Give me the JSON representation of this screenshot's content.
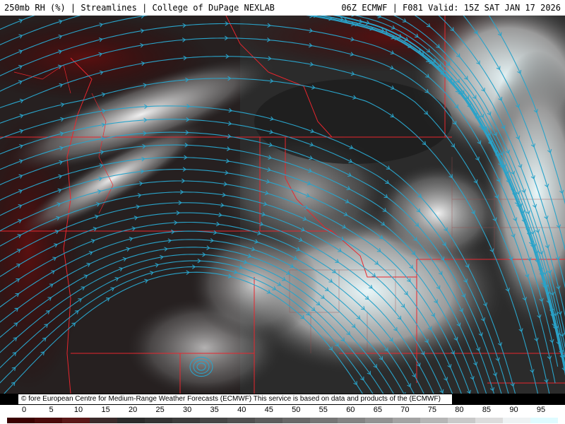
{
  "header": {
    "left_text": "250mb RH (%) | Streamlines | College of DuPage NEXLAB",
    "right_text": "06Z ECMWF | F081 Valid: 15Z SAT JAN 17 2026"
  },
  "map": {
    "field": "250mb RH (%)",
    "overlay": "Streamlines",
    "streamline_color": "#2aa3c9",
    "border_color": "#e8262e",
    "bg_dry": "#3a0000",
    "bg_moist": "#e8fbff"
  },
  "credit_text": "© fore European Centre for Medium-Range Weather Forecasts (ECMWF)  This service is based on data and products of the (ECMWF)",
  "scale": {
    "ticks": [
      "0",
      "5",
      "10",
      "15",
      "20",
      "25",
      "30",
      "35",
      "40",
      "45",
      "50",
      "55",
      "60",
      "65",
      "70",
      "75",
      "80",
      "85",
      "90",
      "95"
    ],
    "colors": [
      "#3a0000",
      "#4a0a0a",
      "#5a1818",
      "#3a2a2a",
      "#2a2a2a",
      "#333333",
      "#3c3c3c",
      "#464646",
      "#505050",
      "#5c5c5c",
      "#686868",
      "#757575",
      "#838383",
      "#929292",
      "#a3a3a3",
      "#b6b6b6",
      "#c9c9c9",
      "#dcdcdc",
      "#eef2f3",
      "#dffbff"
    ]
  }
}
